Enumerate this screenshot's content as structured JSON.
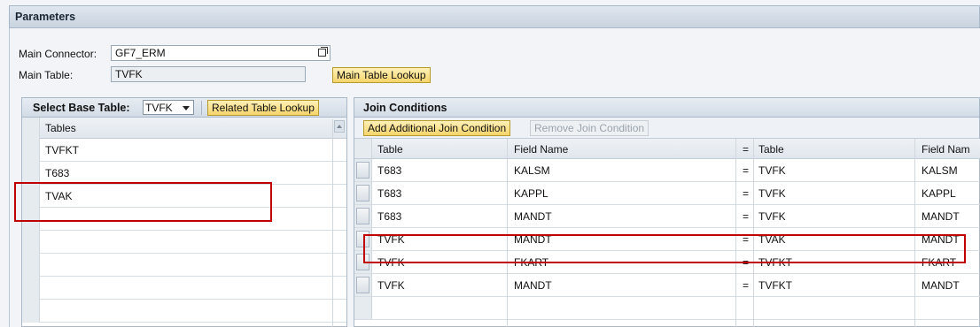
{
  "parameters": {
    "title": "Parameters",
    "main_connector_label": "Main Connector:",
    "main_connector_value": "GF7_ERM",
    "main_table_label": "Main Table:",
    "main_table_value": "TVFK",
    "main_table_lookup_label": "Main Table Lookup"
  },
  "left_panel": {
    "select_base_table_label": "Select Base Table:",
    "base_table_value": "TVFK",
    "related_table_lookup_label": "Related Table Lookup",
    "column_header": "Tables",
    "rows": [
      "TVFKT",
      "T683",
      "TVAK",
      "",
      "",
      "",
      "",
      ""
    ]
  },
  "join_conditions": {
    "title": "Join Conditions",
    "add_button_label": "Add Additional Join Condition",
    "remove_button_label": "Remove Join Condition",
    "headers": [
      "Table",
      "Field Name",
      "=",
      "Table",
      "Field Nam"
    ],
    "rows": [
      [
        "T683",
        "KALSM",
        "=",
        "TVFK",
        "KALSM"
      ],
      [
        "T683",
        "KAPPL",
        "=",
        "TVFK",
        "KAPPL"
      ],
      [
        "T683",
        "MANDT",
        "=",
        "TVFK",
        "MANDT"
      ],
      [
        "TVFK",
        "MANDT",
        "=",
        "TVAK",
        "MANDT"
      ],
      [
        "TVFK",
        "FKART",
        "=",
        "TVFKT",
        "FKART"
      ],
      [
        "TVFK",
        "MANDT",
        "=",
        "TVFKT",
        "MANDT"
      ],
      [
        "",
        "",
        "",
        "",
        ""
      ]
    ]
  },
  "colors": {
    "highlight": "#c00000",
    "button_yellow": "#f5d46a",
    "header_bg": "#c9d4df"
  },
  "icons": {
    "connector_value_help": "restore-window-icon",
    "dropdown": "caret-down-icon",
    "scroll": "scroll-up-icon"
  }
}
